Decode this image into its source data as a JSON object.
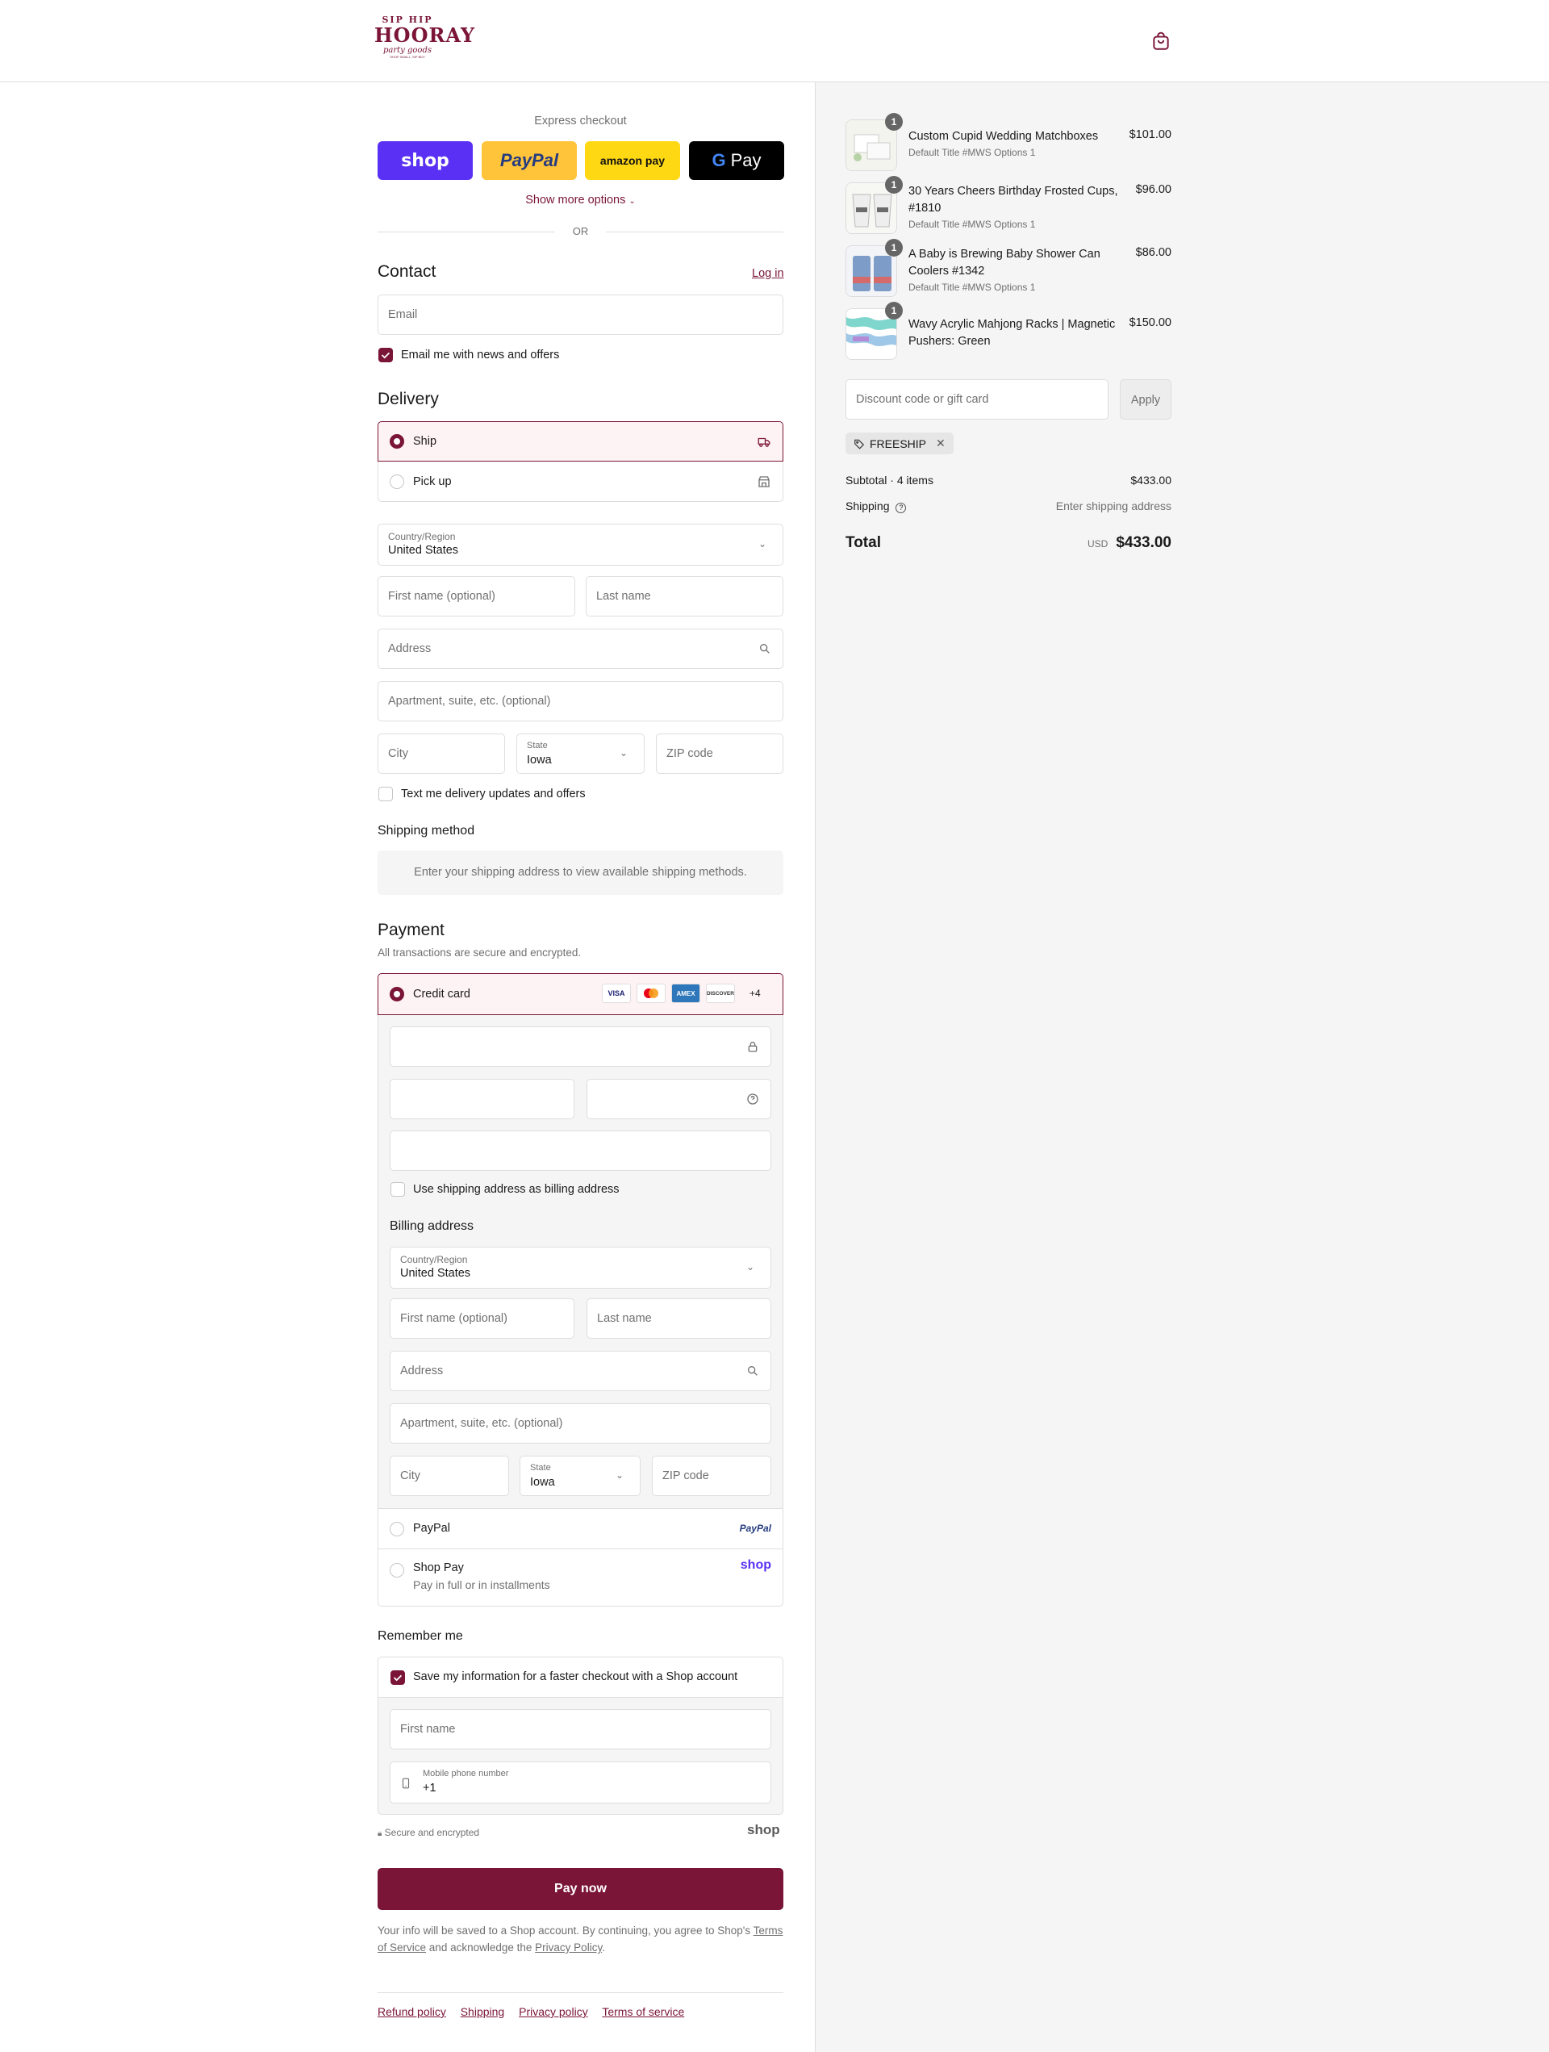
{
  "brand": {
    "logo_lines": [
      "SIP HIP",
      "HOORAY",
      "party goods",
      "SHOP SMALL, SIP BIG!"
    ],
    "accent": "#7a1538"
  },
  "express": {
    "title": "Express checkout",
    "buttons": {
      "shop": "shop",
      "paypal": "PayPal",
      "amazon": "amazon pay",
      "gpay_g": "G",
      "gpay": "Pay"
    },
    "more": "Show more options",
    "or": "OR"
  },
  "contact": {
    "title": "Contact",
    "login": "Log in",
    "email_placeholder": "Email",
    "news_label": "Email me with news and offers"
  },
  "delivery": {
    "title": "Delivery",
    "ship": "Ship",
    "pickup": "Pick up",
    "country_label": "Country/Region",
    "country": "United States",
    "first_name": "First name (optional)",
    "last_name": "Last name",
    "address": "Address",
    "apartment": "Apartment, suite, etc. (optional)",
    "city": "City",
    "state_label": "State",
    "state": "Iowa",
    "zip": "ZIP code",
    "text_updates": "Text me delivery updates and offers"
  },
  "shipping_method": {
    "title": "Shipping method",
    "notice": "Enter your shipping address to view available shipping methods."
  },
  "payment": {
    "title": "Payment",
    "subtitle": "All transactions are secure and encrypted.",
    "credit_card": "Credit card",
    "card_brands": [
      "VISA",
      "",
      "AMEX",
      "DISCOVER"
    ],
    "more_brands": "+4",
    "use_shipping": "Use shipping address as billing address",
    "billing_title": "Billing address",
    "country_label": "Country/Region",
    "country": "United States",
    "first_name": "First name (optional)",
    "last_name": "Last name",
    "address": "Address",
    "apartment": "Apartment, suite, etc. (optional)",
    "city": "City",
    "state_label": "State",
    "state": "Iowa",
    "zip": "ZIP code",
    "paypal": "PayPal",
    "paypal_logo": "PayPal",
    "shoppay": "Shop Pay",
    "shoppay_sub": "Pay in full or in installments",
    "shoppay_logo": "shop"
  },
  "remember": {
    "title": "Remember me",
    "save_label": "Save my information for a faster checkout with a Shop account",
    "first_name": "First name",
    "phone_label": "Mobile phone number",
    "phone_value": "+1",
    "secure": "Secure and encrypted",
    "shop_logo": "shop"
  },
  "pay_now": "Pay now",
  "legal": {
    "part1": "Your info will be saved to a Shop account. By continuing, you agree to Shop's",
    "tos": "Terms of Service",
    "part2": "and acknowledge the",
    "privacy": "Privacy Policy",
    "end": "."
  },
  "footer": [
    "Refund policy",
    "Shipping",
    "Privacy policy",
    "Terms of service"
  ],
  "cart": {
    "items": [
      {
        "qty": "1",
        "name": "Custom Cupid Wedding Matchboxes",
        "variant": "Default Title #MWS Options 1",
        "price": "$101.00"
      },
      {
        "qty": "1",
        "name": "30 Years Cheers Birthday Frosted Cups, #1810",
        "variant": "Default Title #MWS Options 1",
        "price": "$96.00"
      },
      {
        "qty": "1",
        "name": "A Baby is Brewing Baby Shower Can Coolers #1342",
        "variant": "Default Title #MWS Options 1",
        "price": "$86.00"
      },
      {
        "qty": "1",
        "name": "Wavy Acrylic Mahjong Racks | Magnetic Pushers: Green",
        "variant": "",
        "price": "$150.00"
      }
    ],
    "discount_placeholder": "Discount code or gift card",
    "apply": "Apply",
    "code": "FREESHIP",
    "subtotal_label": "Subtotal · 4 items",
    "subtotal": "$433.00",
    "shipping_label": "Shipping",
    "shipping_value": "Enter shipping address",
    "total_label": "Total",
    "currency": "USD",
    "total": "$433.00"
  }
}
